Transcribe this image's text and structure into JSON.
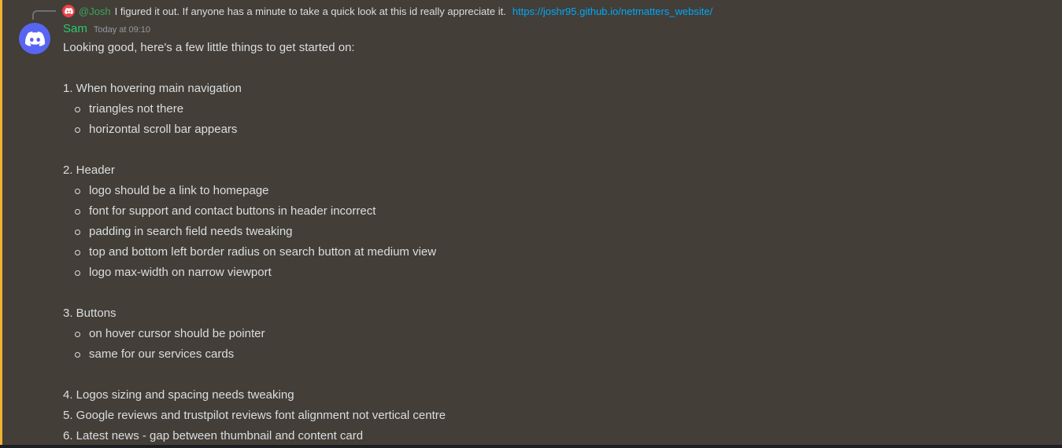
{
  "reply": {
    "mention": "@Josh",
    "text": "I figured it out. If anyone has a minute to take a quick look at this id really appreciate it.",
    "link": "https://joshr95.github.io/netmatters_website/"
  },
  "message": {
    "author": "Sam",
    "timestamp": "Today at 09:10",
    "intro": "Looking good, here's a few little things to get started on:",
    "sections": [
      {
        "heading": "1. When hovering main navigation",
        "items": [
          "triangles not there",
          "horizontal scroll bar appears"
        ]
      },
      {
        "heading": "2. Header",
        "items": [
          "logo should be a link to homepage",
          "font for support and contact buttons in header incorrect",
          "padding in search field needs tweaking",
          "top and bottom left border radius on search button at medium view",
          "logo max-width on narrow viewport"
        ]
      },
      {
        "heading": "3. Buttons",
        "items": [
          "on hover cursor should be pointer",
          "same for our services cards"
        ]
      }
    ],
    "points": [
      "4. Logos sizing and spacing needs tweaking",
      "5. Google reviews and trustpilot reviews font alignment not vertical centre",
      "6. Latest news - gap between thumbnail and content card"
    ]
  },
  "colors": {
    "accent_bar": "#f0b232",
    "username": "#2dc770",
    "link": "#00a8fc",
    "discord_blurple": "#5865f2"
  },
  "icons": {
    "avatar": "discord-logo-icon",
    "reply_avatar": "discord-logo-icon"
  }
}
